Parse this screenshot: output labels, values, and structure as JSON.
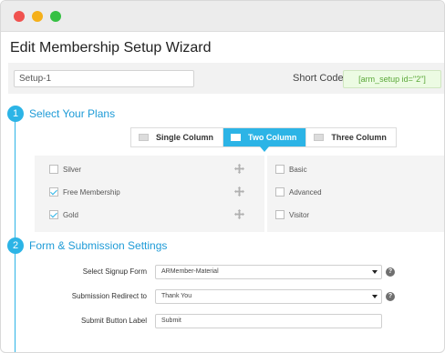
{
  "window": {
    "title": "Edit Membership Setup Wizard"
  },
  "setup": {
    "name_value": "Setup-1",
    "shortcode_label": "Short Code",
    "shortcode_value": "[arm_setup id=\"2\"]"
  },
  "step1": {
    "number": "1",
    "title": "Select Your Plans",
    "column_tabs": [
      {
        "label": "Single Column",
        "active": false
      },
      {
        "label": "Two Column",
        "active": true
      },
      {
        "label": "Three Column",
        "active": false
      }
    ],
    "left_plans": [
      {
        "label": "Silver",
        "checked": false
      },
      {
        "label": "Free Membership",
        "checked": true
      },
      {
        "label": "Gold",
        "checked": true
      }
    ],
    "right_plans": [
      {
        "label": "Basic",
        "checked": false
      },
      {
        "label": "Advanced",
        "checked": false
      },
      {
        "label": "Visitor",
        "checked": false
      }
    ]
  },
  "step2": {
    "number": "2",
    "title": "Form & Submission Settings",
    "signup_form_label": "Select Signup Form",
    "signup_form_value": "ARMember-Material",
    "redirect_label": "Submission Redirect to",
    "redirect_value": "Thank You",
    "button_label_label": "Submit Button Label",
    "button_label_value": "Submit"
  },
  "icons": {
    "help": "?",
    "move": "move-icon",
    "accent_color": "#2cb4e6"
  }
}
